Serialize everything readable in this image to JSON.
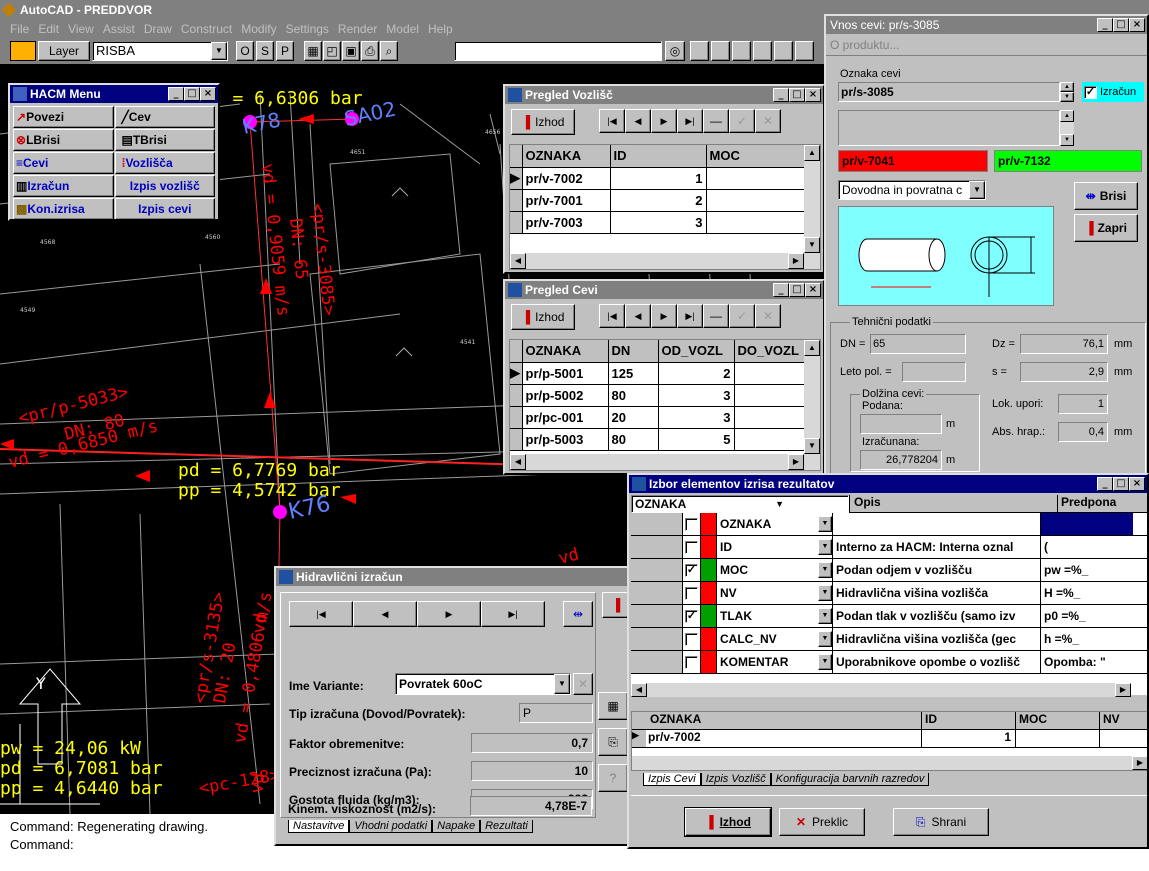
{
  "app": {
    "title": "AutoCAD - PREDDVOR"
  },
  "menu": [
    "File",
    "Edit",
    "View",
    "Assist",
    "Draw",
    "Construct",
    "Modify",
    "Settings",
    "Render",
    "Model",
    "Help"
  ],
  "toolbar": {
    "layer_label": "Layer",
    "layer_value": "RISBA",
    "osp": [
      "O",
      "S",
      "P"
    ]
  },
  "command": {
    "line1": "Command: Regenerating drawing.",
    "line2": "Command:"
  },
  "drawing": {
    "labels_yellow": [
      "pw = 24,06 kW",
      "pd = 6,7081 bar",
      "pp = 4,6440 bar",
      "pd = 6,7769 bar",
      "pp = 4,5742 bar"
    ],
    "labels_red": [
      "vd = 0,9059 m/s",
      "<pr/s-3085>",
      "DN: 65",
      "<pr/p-5033>",
      "DN: 80",
      "vd = 0,6850 m/s",
      "vd = 0,4806 m/s",
      "DN: 20",
      "<pr/s-3135>",
      "vd",
      "vd",
      "vd",
      "<pc-128>"
    ],
    "labels_blue": [
      "K78",
      "SA02",
      "K76"
    ],
    "compass_letter": "Y",
    "top_yellow": [
      "pd = 6,6306 bar"
    ],
    "small_text": [
      "4656",
      "4651",
      "4568",
      "4549",
      "4560",
      "4541"
    ]
  },
  "hacm_menu": {
    "title": "HACM Menu",
    "buttons": [
      [
        "Povezi",
        "Cev"
      ],
      [
        "LBrisi",
        "TBrisi"
      ],
      [
        "Cevi",
        "Vozlišča"
      ],
      [
        "Izračun",
        "Izpis vozlišč"
      ],
      [
        "Kon.izrisa",
        "Izpis cevi"
      ]
    ]
  },
  "pregled_vozlisc": {
    "title": "Pregled Vozlišč",
    "izhod": "Izhod",
    "columns": [
      "OZNAKA",
      "ID",
      "MOC"
    ],
    "rows": [
      [
        "pr/v-7002",
        "1",
        ""
      ],
      [
        "pr/v-7001",
        "2",
        ""
      ],
      [
        "pr/v-7003",
        "3",
        ""
      ]
    ]
  },
  "pregled_cevi": {
    "title": "Pregled Cevi",
    "izhod": "Izhod",
    "columns": [
      "OZNAKA",
      "DN",
      "OD_VOZL",
      "DO_VOZL"
    ],
    "rows": [
      [
        "pr/p-5001",
        "125",
        "2",
        ""
      ],
      [
        "pr/p-5002",
        "80",
        "3",
        ""
      ],
      [
        "pr/pc-001",
        "20",
        "3",
        ""
      ],
      [
        "pr/p-5003",
        "80",
        "5",
        ""
      ]
    ]
  },
  "vnos_cevi": {
    "title": "Vnos cevi: pr/s-3085",
    "about": "O produktu...",
    "oznaka_label": "Oznaka cevi",
    "oznaka_value": "pr/s-3085",
    "izracun_label": "Izračun",
    "from_node": "pr/v-7041",
    "to_node": "pr/v-7132",
    "tip_select": "Dovodna in povratna c",
    "brisi": "Brisi",
    "zapri": "Zapri",
    "tehnicni": "Tehnični podatki",
    "dn_label": "DN =",
    "dn_value": "65",
    "dz_label": "Dz =",
    "dz_value": "76,1",
    "dz_unit": "mm",
    "leto_label": "Leto pol. =",
    "leto_value": "",
    "s_label": "s =",
    "s_value": "2,9",
    "s_unit": "mm",
    "dolzina_label": "Dolžina cevi:",
    "podana_label": "Podana:",
    "podana_value": "",
    "podana_unit": "m",
    "lok_label": "Lok. upori:",
    "lok_value": "1",
    "abs_label": "Abs. hrap.:",
    "abs_value": "0,4",
    "abs_unit": "mm",
    "izracunana_label": "Izračunana:",
    "izracunana_value": "26,778204",
    "izracunana_unit": "m"
  },
  "hidravlicni": {
    "title": "Hidravlični izračun",
    "ime_label": "Ime Variante:",
    "ime_value": "Povratek 60oC",
    "tip_label": "Tip izračuna (Dovod/Povratek):",
    "tip_value": "P",
    "faktor_label": "Faktor obremenitve:",
    "faktor_value": "0,7",
    "prec_label": "Preciznost izračuna (Pa):",
    "prec_value": "10",
    "gost_label": "Gostota fluida (kg/m3):",
    "gost_value": "983",
    "kin_label": "Kinem. viskoznost (m2/s):",
    "kin_value": "4,78E-7",
    "tabs": [
      "Nastavitve",
      "Vhodni podatki",
      "Napake",
      "Rezultati"
    ]
  },
  "izbor": {
    "title": "Izbor elementov izrisa rezultatov",
    "combo": "OZNAKA",
    "col_opis": "Opis",
    "col_predpona": "Predpona",
    "rows": [
      {
        "checked": false,
        "color": "#ff0000",
        "name": "OZNAKA",
        "opis": "",
        "predpona": ""
      },
      {
        "checked": false,
        "color": "#ff0000",
        "name": "ID",
        "opis": "Interno za HACM: Interna oznal",
        "predpona": "("
      },
      {
        "checked": true,
        "color": "#00a000",
        "name": "MOC",
        "opis": "Podan odjem v vozlišču",
        "predpona": "pw =%_"
      },
      {
        "checked": false,
        "color": "#ff0000",
        "name": "NV",
        "opis": "Hidravlična višina vozlišča",
        "predpona": "H =%_"
      },
      {
        "checked": true,
        "color": "#00a000",
        "name": "TLAK",
        "opis": "Podan tlak v vozlišču (samo izv",
        "predpona": "p0 =%_"
      },
      {
        "checked": false,
        "color": "#ff0000",
        "name": "CALC_NV",
        "opis": "Hidravlična višina vozlišča (gec",
        "predpona": "h =%_"
      },
      {
        "checked": false,
        "color": "#ff0000",
        "name": "KOMENTAR",
        "opis": "Uporabnikove opombe o vozlišč",
        "predpona": "Opomba: \""
      }
    ],
    "bottom_cols": [
      "OZNAKA",
      "ID",
      "MOC",
      "NV"
    ],
    "bottom_row": [
      "pr/v-7002",
      "1",
      "",
      ""
    ],
    "tabs": [
      "Izpis Cevi",
      "Izpis Vozlišč",
      "Konfiguracija barvnih razredov"
    ],
    "izhod": "Izhod",
    "preklic": "Preklic",
    "shrani": "Shrani"
  }
}
